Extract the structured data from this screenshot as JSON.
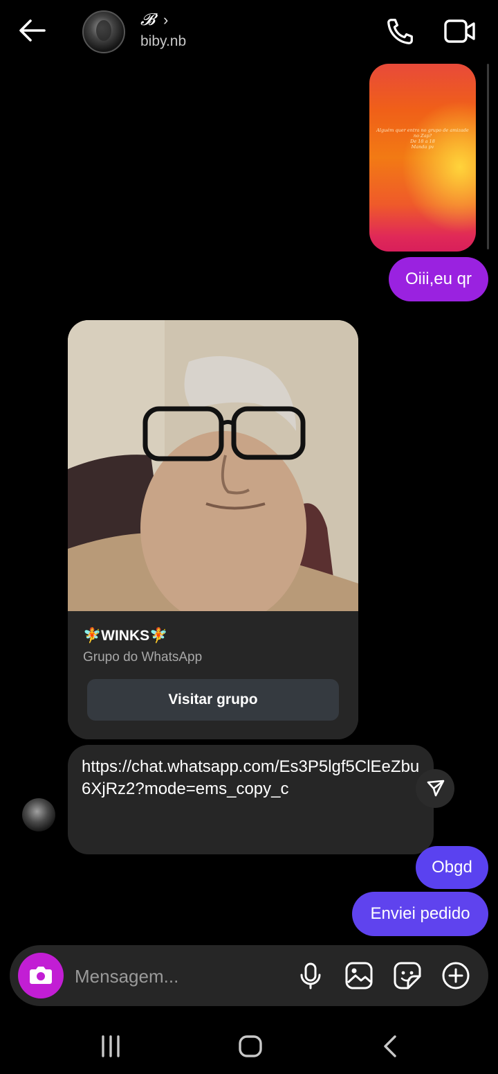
{
  "header": {
    "name": "𝓑",
    "chevron": "›",
    "username": "biby.nb",
    "icons": [
      "back-arrow-icon",
      "avatar",
      "phone-icon",
      "video-camera-icon"
    ]
  },
  "story": {
    "text_lines": [
      "Alguém quer entra no grupo de amizade no Zap?",
      "De 18 a 18",
      "Manda pv"
    ]
  },
  "messages": {
    "outgoing_1": "Oiii,eu qr",
    "wa_card": {
      "title": "🧚WINKS🧚",
      "subtitle": "Grupo do WhatsApp",
      "button_label": "Visitar grupo"
    },
    "link": "https://chat.whatsapp.com/Es3P5lgf5ClEeZbu6XjRz2?mode=ems_copy_c",
    "outgoing_2": "Obgd",
    "outgoing_3": "Enviei pedido"
  },
  "composer": {
    "placeholder": "Mensagem...",
    "icons": [
      "camera-icon",
      "microphone-icon",
      "gallery-icon",
      "sticker-icon",
      "plus-icon"
    ]
  },
  "navbar": {
    "icons": [
      "recent-apps-icon",
      "home-icon",
      "back-icon"
    ]
  },
  "colors": {
    "outgoing_purple": "#9a22e0",
    "outgoing_blue": "#5a42f0",
    "camera_magenta": "#c21ed4",
    "bubble_dark": "#262626"
  }
}
